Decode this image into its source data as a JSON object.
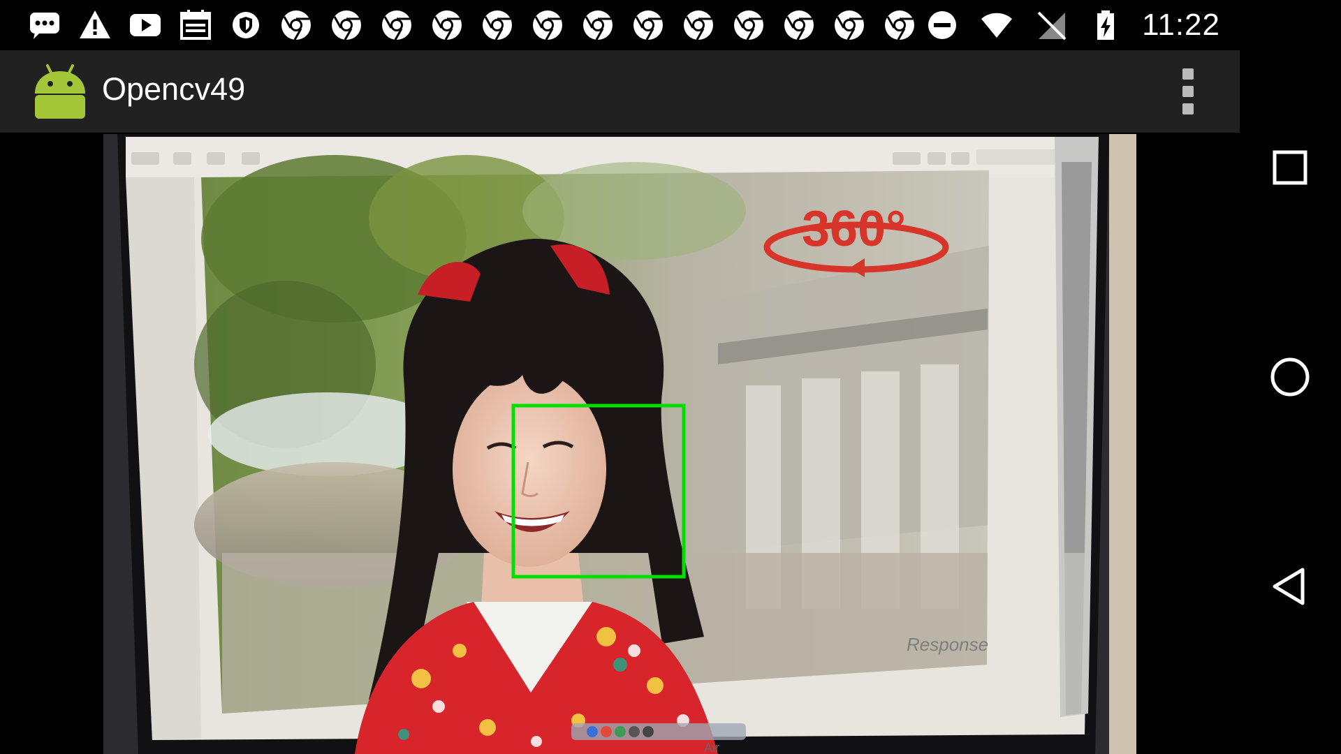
{
  "status_bar": {
    "time": "11:22",
    "notification_icons": [
      "more-messages-icon",
      "warning-icon",
      "youtube-icon",
      "calendar-icon",
      "vpn-shield-icon",
      "chrome-icon",
      "chrome-icon",
      "chrome-icon",
      "chrome-icon",
      "chrome-icon",
      "chrome-icon",
      "chrome-icon",
      "chrome-icon",
      "chrome-icon",
      "chrome-icon",
      "chrome-icon",
      "chrome-icon",
      "chrome-icon"
    ],
    "system_icons": [
      "do-not-disturb-icon",
      "wifi-icon",
      "no-sim-icon",
      "battery-charging-icon"
    ]
  },
  "app_bar": {
    "title": "Opencv49",
    "overflow_icon": "more-vert-icon"
  },
  "camera": {
    "screen_watermark": "Response",
    "overlay_badge": "360°",
    "laptop_label": "Air",
    "face_box_color": "#00e000",
    "faces_detected": 1
  },
  "nav_bar": {
    "buttons": [
      "recents-button",
      "home-button",
      "back-button"
    ]
  },
  "colors": {
    "status_bar": "#000000",
    "app_bar": "#212121",
    "android_green": "#a4c639",
    "kimono_red": "#d8252c"
  }
}
